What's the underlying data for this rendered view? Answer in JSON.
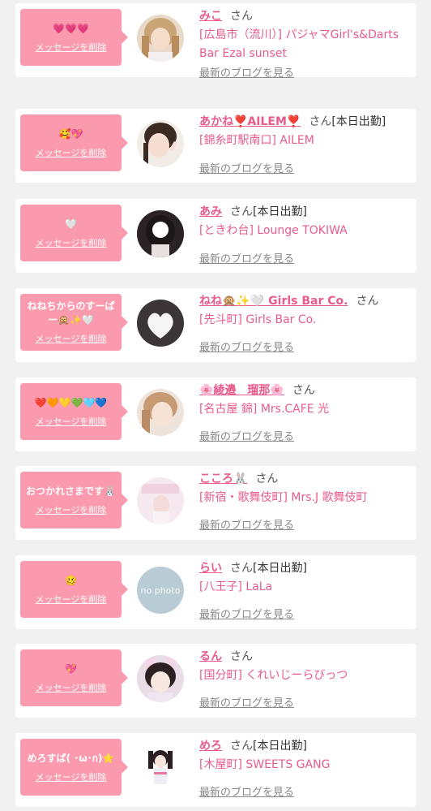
{
  "cards": [
    {
      "message": "💗💗💗",
      "delete_label": "メッセージを削除",
      "name": "みこ",
      "honorific": "さん",
      "status": "",
      "shop": "[広島市（流川）] パジャマGirl's&Darts Bar Ezal sunset",
      "blog_label": "最新のブログを見る"
    },
    {
      "message": "🥰💖",
      "delete_label": "メッセージを削除",
      "name": "あかね❣️AILEM❣️",
      "honorific": "さん",
      "status": "[本日出勤]",
      "shop": "[錦糸町駅南口] AILEM",
      "blog_label": "最新のブログを見る"
    },
    {
      "message": "🤍",
      "delete_label": "メッセージを削除",
      "name": "あみ",
      "honorific": "さん",
      "status": "[本日出勤]",
      "shop": "[ときわ台] Lounge TOKIWA",
      "blog_label": "最新のブログを見る"
    },
    {
      "message": "ねねちからのすーぱー🙊✨🤍",
      "delete_label": "メッセージを削除",
      "name": "ねね🙊✨🤍 Girls Bar Co.",
      "honorific": "さん",
      "status": "",
      "shop": "[先斗町] Girls Bar Co.",
      "blog_label": "最新のブログを見る"
    },
    {
      "message": "❤️🧡💛💚🩵💙",
      "delete_label": "メッセージを削除",
      "name": "🌸綾邉　瑠那🌸",
      "honorific": "さん",
      "status": "",
      "shop": "[名古屋 錦] Mrs.CAFE 光",
      "blog_label": "最新のブログを見る"
    },
    {
      "message": "おつかれさまです🐰",
      "delete_label": "メッセージを削除",
      "name": "こころ🐰",
      "honorific": "さん",
      "status": "",
      "shop": "[新宿・歌舞伎町] Mrs.J 歌舞伎町",
      "blog_label": "最新のブログを見る"
    },
    {
      "message": "🥴",
      "delete_label": "メッセージを削除",
      "name": "らい",
      "honorific": "さん",
      "status": "[本日出勤]",
      "shop": "[八王子] LaLa",
      "blog_label": "最新のブログを見る",
      "avatar_text": "no photo"
    },
    {
      "message": "💖",
      "delete_label": "メッセージを削除",
      "name": "るん",
      "honorific": "さん",
      "status": "",
      "shop": "[国分町] くれいじーらびっつ",
      "blog_label": "最新のブログを見る"
    },
    {
      "message": "めろすば( ･ω･ก)⭐",
      "delete_label": "メッセージを削除",
      "name": "めろ",
      "honorific": "さん",
      "status": "[本日出勤]",
      "shop": "[木屋町] SWEETS GANG",
      "blog_label": "最新のブログを見る"
    }
  ],
  "colors": {
    "bubble": "#fb9aae",
    "name": "#e95b8b",
    "shop": "#e95b8b",
    "blog": "#888888",
    "background": "#f1f1f1"
  }
}
